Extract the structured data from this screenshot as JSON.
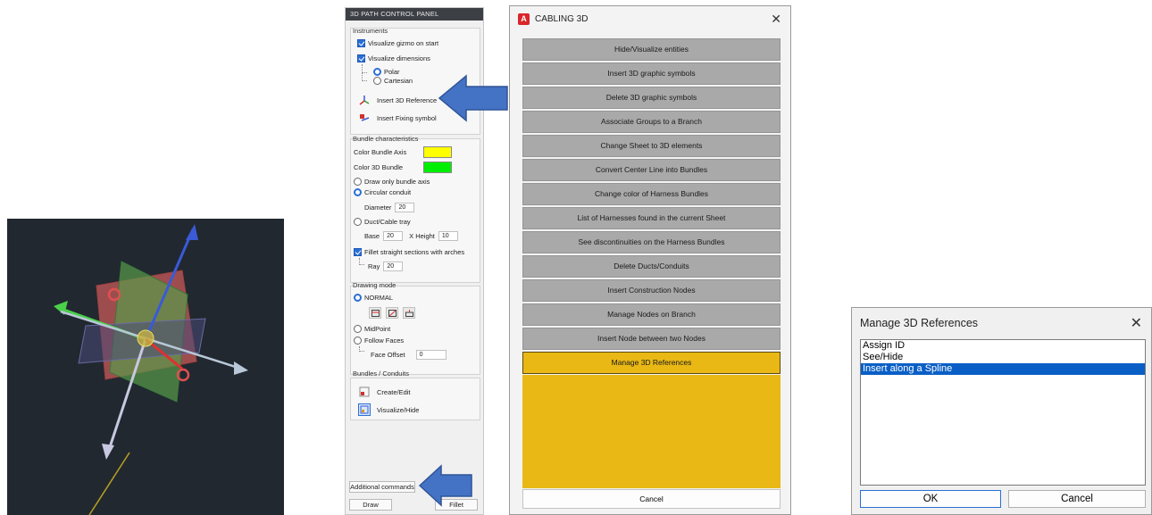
{
  "viewport": {
    "background": "#212830"
  },
  "panel": {
    "title": "3D PATH CONTROL PANEL",
    "instruments": {
      "title": "Instruments",
      "visualize_gizmo": "Visualize gizmo on start",
      "visualize_dimensions": "Visualize dimensions",
      "polar": "Polar",
      "cartesian": "Cartesian",
      "insert_3d_reference": "Insert 3D Reference",
      "insert_fixing_symbol": "Insert Fixing symbol"
    },
    "bundle": {
      "title": "Bundle characteristics",
      "color_axis": "Color Bundle Axis",
      "color_axis_value": "#ffff00",
      "color_bundle": "Color 3D Bundle",
      "color_bundle_value": "#00ee00",
      "draw_only_axis": "Draw only bundle axis",
      "circular_conduit": "Circular conduit",
      "diameter_label": "Diameter",
      "diameter_value": "20",
      "duct_cable_tray": "Duct/Cable tray",
      "base_label": "Base",
      "base_value": "20",
      "height_label": "X Height",
      "height_value": "10",
      "fillet": "Fillet straight sections with arches",
      "ray_label": "Ray",
      "ray_value": "20"
    },
    "drawing": {
      "title": "Drawing mode",
      "normal": "NORMAL",
      "midpoint": "MidPoint",
      "follow_faces": "Follow Faces",
      "face_offset_label": "Face Offset",
      "face_offset_value": "0"
    },
    "conduits": {
      "title": "Bundles / Conduits",
      "create_edit": "Create/Edit",
      "visualize_hide": "Visualize/Hide"
    },
    "additional_commands": "Additional commands",
    "draw": "Draw",
    "fillet_btn": "Fillet"
  },
  "cabling": {
    "title": "CABLING 3D",
    "logo": "A",
    "buttons": [
      "Hide/Visualize entities",
      "Insert 3D graphic symbols",
      "Delete 3D graphic symbols",
      "Associate Groups to a Branch",
      "Change Sheet to 3D elements",
      "Convert Center Line into Bundles",
      "Change color of Harness Bundles",
      "List of Harnesses found in the current Sheet",
      "See discontinuities on the Harness Bundles",
      "Delete Ducts/Conduits",
      "Insert Construction Nodes",
      "Manage Nodes on Branch",
      "Insert Node between two Nodes",
      "Manage 3D References"
    ],
    "selected_index": 13,
    "cancel": "Cancel",
    "accent": "#e9b815"
  },
  "manage_refs": {
    "title": "Manage 3D References",
    "items": [
      "Assign ID",
      "See/Hide",
      "Insert along a Spline"
    ],
    "selected_index": 2,
    "ok": "OK",
    "cancel": "Cancel",
    "selection_color": "#0a5fc6"
  },
  "arrow_color": "#4472c4"
}
